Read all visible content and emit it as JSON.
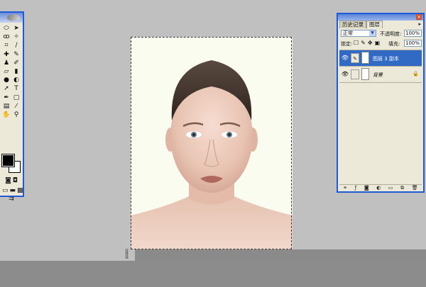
{
  "toolbox": {
    "tools": [
      {
        "icon": "marquee-icon",
        "glyph": "⬭"
      },
      {
        "icon": "move-icon",
        "glyph": "➤"
      },
      {
        "icon": "lasso-icon",
        "glyph": "ꝏ"
      },
      {
        "icon": "magic-wand-icon",
        "glyph": "✧"
      },
      {
        "icon": "crop-icon",
        "glyph": "⌗"
      },
      {
        "icon": "slice-icon",
        "glyph": "∕"
      },
      {
        "icon": "healing-brush-icon",
        "glyph": "✚"
      },
      {
        "icon": "brush-icon",
        "glyph": "✎"
      },
      {
        "icon": "stamp-icon",
        "glyph": "♟"
      },
      {
        "icon": "history-brush-icon",
        "glyph": "✐"
      },
      {
        "icon": "eraser-icon",
        "glyph": "▱"
      },
      {
        "icon": "gradient-icon",
        "glyph": "▮"
      },
      {
        "icon": "blur-icon",
        "glyph": "●"
      },
      {
        "icon": "dodge-icon",
        "glyph": "◐"
      },
      {
        "icon": "path-select-icon",
        "glyph": "➚"
      },
      {
        "icon": "type-icon",
        "glyph": "T"
      },
      {
        "icon": "pen-icon",
        "glyph": "✒"
      },
      {
        "icon": "shape-icon",
        "glyph": "▢"
      },
      {
        "icon": "notes-icon",
        "glyph": "▤"
      },
      {
        "icon": "eyedropper-icon",
        "glyph": "⁄"
      },
      {
        "icon": "hand-icon",
        "glyph": "✋"
      },
      {
        "icon": "zoom-icon",
        "glyph": "⚲"
      }
    ],
    "mode_icons": [
      {
        "icon": "standard-mode-icon",
        "glyph": "◙"
      },
      {
        "icon": "quick-mask-icon",
        "glyph": "◘"
      }
    ],
    "screen_icons": [
      {
        "icon": "screen-mode-standard-icon",
        "glyph": "▭"
      },
      {
        "icon": "screen-mode-full-menu-icon",
        "glyph": "▬"
      },
      {
        "icon": "screen-mode-full-icon",
        "glyph": "▩"
      }
    ],
    "jump_icons": [
      {
        "icon": "jump-to-imageready-icon",
        "glyph": "⇉"
      }
    ],
    "fg_color": "#000000",
    "bg_color": "#ffffff"
  },
  "layers_panel": {
    "tabs": [
      {
        "label": "历史记录",
        "active": false
      },
      {
        "label": "图层",
        "active": true
      }
    ],
    "blend_mode": "正常",
    "opacity_label": "不透明度:",
    "opacity_value": "100%",
    "lock_label": "锁定:",
    "fill_label": "填充:",
    "fill_value": "100%",
    "layers": [
      {
        "name": "图层 3 副本",
        "selected": true,
        "italic": false,
        "locked": false
      },
      {
        "name": "背景",
        "selected": false,
        "italic": true,
        "locked": true
      }
    ]
  },
  "colors": {
    "workspace": "#c0c0c0",
    "selection": "#316ac5",
    "window_frame": "#1f5bd6"
  }
}
